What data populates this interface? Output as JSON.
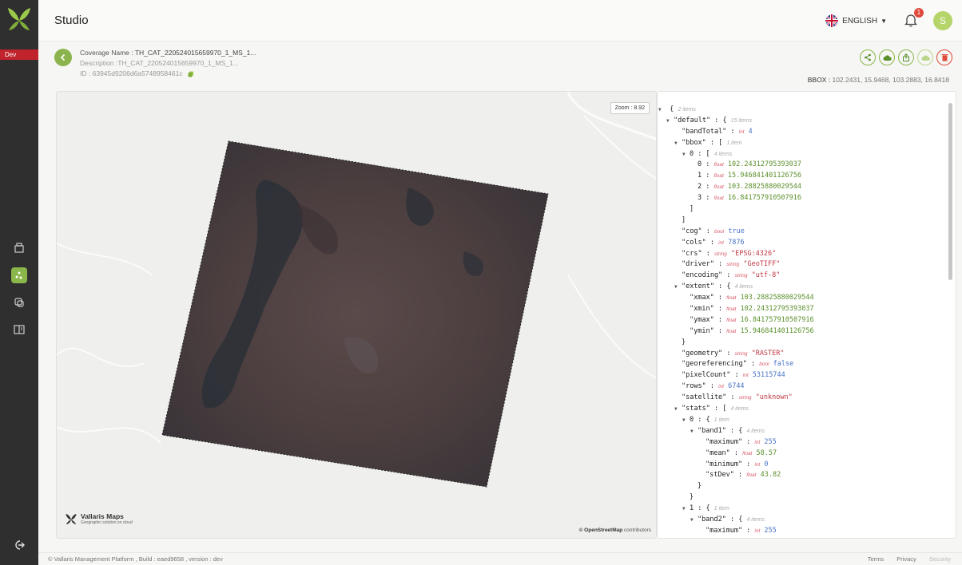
{
  "app": {
    "title": "Studio",
    "env": "Dev"
  },
  "header": {
    "language": "ENGLISH",
    "notifications": "1",
    "avatar": "S"
  },
  "coverage": {
    "name_label": "Coverage Name :",
    "name": "TH_CAT_220524015659970_1_MS_1...",
    "desc_label": "Description :",
    "desc": "TH_CAT_220524015659970_1_MS_1...",
    "id_label": "ID :",
    "id": "63945d9206d6a5748958461c"
  },
  "bbox": {
    "label": "BBOX :",
    "value": "102.2431, 15.9468, 103.2883, 16.8418"
  },
  "map": {
    "zoom": "Zoom : 8.92",
    "brand": "Vallaris Maps",
    "tagline": "Geographic solution on cloud",
    "attribution_bold": "© OpenStreetMap",
    "attribution_rest": " contributors"
  },
  "json_rows": [
    {
      "i": 0,
      "tog": true,
      "k": "",
      "type": "",
      "val": "{",
      "note": "2 items",
      "vc": ""
    },
    {
      "i": 1,
      "tog": true,
      "k": "\"default\" :",
      "type": "",
      "val": "{",
      "note": "15 items",
      "vc": ""
    },
    {
      "i": 2,
      "tog": false,
      "k": "\"bandTotal\" :",
      "type": "int",
      "val": "4",
      "note": "",
      "vc": "vi"
    },
    {
      "i": 2,
      "tog": true,
      "k": "\"bbox\" :",
      "type": "",
      "val": "[",
      "note": "1 item",
      "vc": ""
    },
    {
      "i": 3,
      "tog": true,
      "k": "0 :",
      "type": "",
      "val": "[",
      "note": "4 items",
      "vc": ""
    },
    {
      "i": 4,
      "tog": false,
      "k": "0 :",
      "type": "float",
      "val": "102.24312795393037",
      "note": "",
      "vc": "vf"
    },
    {
      "i": 4,
      "tog": false,
      "k": "1 :",
      "type": "float",
      "val": "15.946841401126756",
      "note": "",
      "vc": "vf"
    },
    {
      "i": 4,
      "tog": false,
      "k": "2 :",
      "type": "float",
      "val": "103.28825880029544",
      "note": "",
      "vc": "vf"
    },
    {
      "i": 4,
      "tog": false,
      "k": "3 :",
      "type": "float",
      "val": "16.841757910507916",
      "note": "",
      "vc": "vf"
    },
    {
      "i": 3,
      "tog": false,
      "k": "]",
      "type": "",
      "val": "",
      "note": "",
      "vc": ""
    },
    {
      "i": 2,
      "tog": false,
      "k": "]",
      "type": "",
      "val": "",
      "note": "",
      "vc": ""
    },
    {
      "i": 2,
      "tog": false,
      "k": "\"cog\" :",
      "type": "bool",
      "val": "true",
      "note": "",
      "vc": "vb"
    },
    {
      "i": 2,
      "tog": false,
      "k": "\"cols\" :",
      "type": "int",
      "val": "7876",
      "note": "",
      "vc": "vi"
    },
    {
      "i": 2,
      "tog": false,
      "k": "\"crs\" :",
      "type": "string",
      "val": "\"EPSG:4326\"",
      "note": "",
      "vc": "vs"
    },
    {
      "i": 2,
      "tog": false,
      "k": "\"driver\" :",
      "type": "string",
      "val": "\"GeoTIFF\"",
      "note": "",
      "vc": "vs"
    },
    {
      "i": 2,
      "tog": false,
      "k": "\"encoding\" :",
      "type": "string",
      "val": "\"utf-8\"",
      "note": "",
      "vc": "vs"
    },
    {
      "i": 2,
      "tog": true,
      "k": "\"extent\" :",
      "type": "",
      "val": "{",
      "note": "4 items",
      "vc": ""
    },
    {
      "i": 3,
      "tog": false,
      "k": "\"xmax\" :",
      "type": "float",
      "val": "103.28825880029544",
      "note": "",
      "vc": "vf"
    },
    {
      "i": 3,
      "tog": false,
      "k": "\"xmin\" :",
      "type": "float",
      "val": "102.24312795393037",
      "note": "",
      "vc": "vf"
    },
    {
      "i": 3,
      "tog": false,
      "k": "\"ymax\" :",
      "type": "float",
      "val": "16.841757910507916",
      "note": "",
      "vc": "vf"
    },
    {
      "i": 3,
      "tog": false,
      "k": "\"ymin\" :",
      "type": "float",
      "val": "15.946841401126756",
      "note": "",
      "vc": "vf"
    },
    {
      "i": 2,
      "tog": false,
      "k": "}",
      "type": "",
      "val": "",
      "note": "",
      "vc": ""
    },
    {
      "i": 2,
      "tog": false,
      "k": "\"geometry\" :",
      "type": "string",
      "val": "\"RASTER\"",
      "note": "",
      "vc": "vs"
    },
    {
      "i": 2,
      "tog": false,
      "k": "\"georeferencing\" :",
      "type": "bool",
      "val": "false",
      "note": "",
      "vc": "vb"
    },
    {
      "i": 2,
      "tog": false,
      "k": "\"pixelCount\" :",
      "type": "int",
      "val": "53115744",
      "note": "",
      "vc": "vi"
    },
    {
      "i": 2,
      "tog": false,
      "k": "\"rows\" :",
      "type": "int",
      "val": "6744",
      "note": "",
      "vc": "vi"
    },
    {
      "i": 2,
      "tog": false,
      "k": "\"satellite\" :",
      "type": "string",
      "val": "\"unknown\"",
      "note": "",
      "vc": "vs"
    },
    {
      "i": 2,
      "tog": true,
      "k": "\"stats\" :",
      "type": "",
      "val": "[",
      "note": "4 items",
      "vc": ""
    },
    {
      "i": 3,
      "tog": true,
      "k": "0 :",
      "type": "",
      "val": "{",
      "note": "1 item",
      "vc": ""
    },
    {
      "i": 4,
      "tog": true,
      "k": "\"band1\" :",
      "type": "",
      "val": "{",
      "note": "4 items",
      "vc": ""
    },
    {
      "i": 5,
      "tog": false,
      "k": "\"maximum\" :",
      "type": "int",
      "val": "255",
      "note": "",
      "vc": "vi"
    },
    {
      "i": 5,
      "tog": false,
      "k": "\"mean\" :",
      "type": "float",
      "val": "58.57",
      "note": "",
      "vc": "vf"
    },
    {
      "i": 5,
      "tog": false,
      "k": "\"minimum\" :",
      "type": "int",
      "val": "0",
      "note": "",
      "vc": "vi"
    },
    {
      "i": 5,
      "tog": false,
      "k": "\"stDev\" :",
      "type": "float",
      "val": "43.82",
      "note": "",
      "vc": "vf"
    },
    {
      "i": 4,
      "tog": false,
      "k": "}",
      "type": "",
      "val": "",
      "note": "",
      "vc": ""
    },
    {
      "i": 3,
      "tog": false,
      "k": "}",
      "type": "",
      "val": "",
      "note": "",
      "vc": ""
    },
    {
      "i": 3,
      "tog": true,
      "k": "1 :",
      "type": "",
      "val": "{",
      "note": "1 item",
      "vc": ""
    },
    {
      "i": 4,
      "tog": true,
      "k": "\"band2\" :",
      "type": "",
      "val": "{",
      "note": "4 items",
      "vc": ""
    },
    {
      "i": 5,
      "tog": false,
      "k": "\"maximum\" :",
      "type": "int",
      "val": "255",
      "note": "",
      "vc": "vi"
    }
  ],
  "footer": {
    "text": "© Vallaris Management Platform , Build : eaed9658 , version : dev",
    "terms": "Terms",
    "privacy": "Privacy",
    "security": "Security"
  },
  "colors": {
    "accent": "#8ab64a",
    "sidebar": "#2f2f2f",
    "danger": "#e04a3c"
  }
}
